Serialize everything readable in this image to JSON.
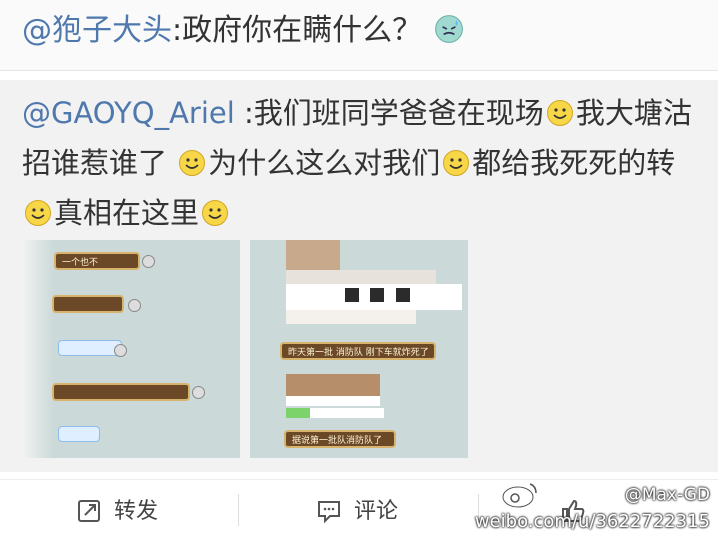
{
  "top_comment": {
    "mention": "@狍子大头",
    "text": ":政府你在瞒什么？",
    "emoji": "sweat-face-icon"
  },
  "repost": {
    "mention": "@GAOYQ_Ariel",
    "segments": [
      ":我们班同学爸爸在现场",
      "我大塘沽招谁惹谁了",
      "为什么这么对我们",
      "都给我死死的转",
      "真相在这里"
    ],
    "emoji": "smile-face-icon"
  },
  "chat_left": {
    "messages": [
      "一个也不"
    ],
    "bubble_count_visible": 5,
    "note": ""
  },
  "chat_right": {
    "message_1": "昨天第一批 消防队 刚下车就炸死了",
    "message_2": "据说第一批队消防队了"
  },
  "actions": {
    "repost_label": "转发",
    "comment_label": "评论"
  },
  "watermark": {
    "handle": "@Max-GD",
    "url": "weibo.com/u/3622722315"
  },
  "colors": {
    "mention": "#4f78ad",
    "chat_bg": "#cbd9d8",
    "bubble": "#6b4826"
  }
}
